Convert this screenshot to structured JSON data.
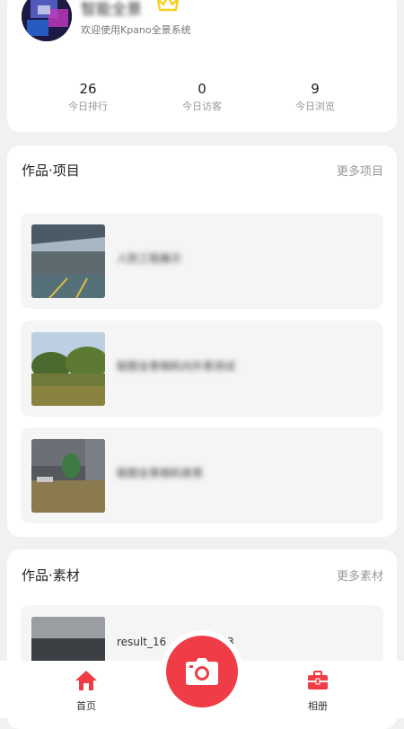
{
  "profile": {
    "username": "智能全景",
    "welcome": "欢迎使用Kpano全景系统",
    "stats": [
      {
        "value": "26",
        "label": "今日排行"
      },
      {
        "value": "0",
        "label": "今日访客"
      },
      {
        "value": "9",
        "label": "今日浏览"
      }
    ]
  },
  "projects": {
    "title": "作品·项目",
    "more": "更多项目",
    "items": [
      {
        "name": "人防工程展示"
      },
      {
        "name": "聪图全景相机内外景测试"
      },
      {
        "name": "聪图全景相机夜景"
      }
    ]
  },
  "materials": {
    "title": "作品·素材",
    "more": "更多素材",
    "items": [
      {
        "name": "result_16"
      },
      {
        "name": "3"
      }
    ]
  },
  "nav": {
    "home": "首页",
    "album": "相册"
  },
  "colors": {
    "accent": "#f03c46",
    "crown": "#f6d21c"
  }
}
